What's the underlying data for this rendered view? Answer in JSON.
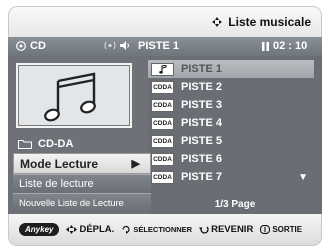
{
  "header": {
    "title": "Liste musicale",
    "title_icon": "diamond-arrows-icon"
  },
  "status": {
    "source": "CD",
    "source_icon": "disc-icon",
    "track_label": "PISTE 1",
    "time": "02 : 10",
    "play_icon": "pause-icon"
  },
  "album_art_icon": "music-notes-icon",
  "folder_label": "CD-DA",
  "menu": {
    "items": [
      "Mode Lecture",
      "Liste de lecture",
      "Nouvelle Liste de Lecture"
    ],
    "selected_arrow": "▶"
  },
  "tracks": [
    {
      "badge": "",
      "name": "PISTE 1",
      "selected": true
    },
    {
      "badge": "CDDA",
      "name": "PISTE 2"
    },
    {
      "badge": "CDDA",
      "name": "PISTE 3"
    },
    {
      "badge": "CDDA",
      "name": "PISTE 4"
    },
    {
      "badge": "CDDA",
      "name": "PISTE 5"
    },
    {
      "badge": "CDDA",
      "name": "PISTE 6"
    },
    {
      "badge": "CDDA",
      "name": "PISTE 7"
    }
  ],
  "page_indicator": "1/3 Page",
  "help": {
    "anykey": "Anykey",
    "move": "DÉPLA.",
    "select": "SÉLECTIONNER",
    "back": "REVENIR",
    "exit": "SORTIE"
  },
  "colors": {
    "panel": "#6a6e74",
    "status_bar": "#7b8187",
    "accent": "#ffffff"
  }
}
